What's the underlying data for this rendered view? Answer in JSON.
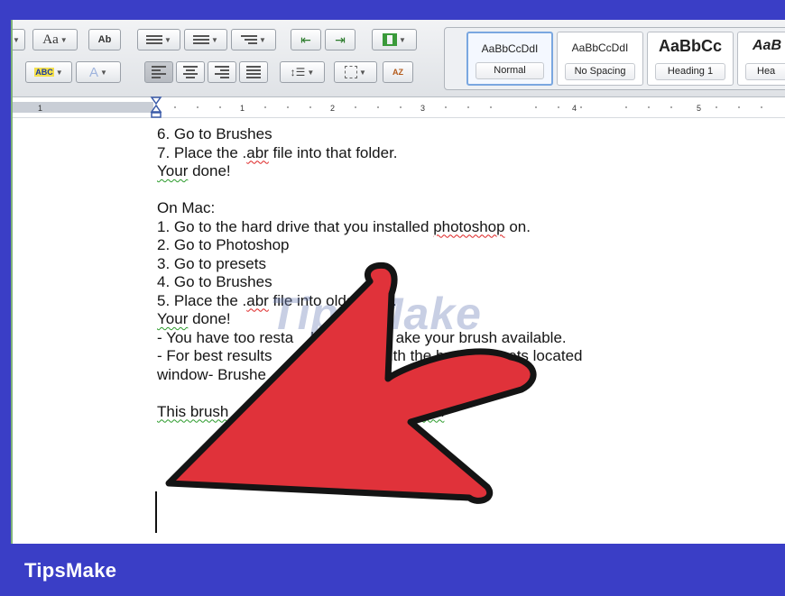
{
  "ribbon": {
    "styles": [
      {
        "sample": "AaBbCcDdI",
        "name": "Normal",
        "selected": true
      },
      {
        "sample": "AaBbCcDdI",
        "name": "No Spacing",
        "selected": false
      },
      {
        "sample": "AaBbCc",
        "name": "Heading 1",
        "selected": false
      },
      {
        "sample": "AaB",
        "name": "Hea",
        "selected": false
      }
    ],
    "font_size_label": "Aa",
    "spell_label": "Ab",
    "highlight_label": "ABC",
    "sort_label": "AZ"
  },
  "ruler": {
    "tick_labels": [
      "1",
      "1",
      "2",
      "3",
      "4",
      "5"
    ]
  },
  "document": {
    "lines": [
      "6. Go to Brushes",
      "7. Place the .abr file into that folder.",
      "Your done!",
      "",
      "On Mac:",
      "1. Go to the hard drive that you installed photoshop on.",
      "2. Go to Photoshop",
      "3. Go to presets",
      "4. Go to Brushes",
      "5. Place the .abr file into olda older.",
      "Your done!",
      "- You have too resta    hop in ord    ake your brush available.",
      "- For best results         nt to         with the brush presets located",
      "window- Brushe",
      "",
      "This brush                           deviantart.com"
    ]
  },
  "watermark": "TipsMake",
  "brand": "TipsMake",
  "colors": {
    "frame": "#3a3ec6",
    "arrow_fill": "#e0323a",
    "arrow_outline": "#141414",
    "spellcheck": "#d22222",
    "grammar": "#2a9a2a"
  }
}
